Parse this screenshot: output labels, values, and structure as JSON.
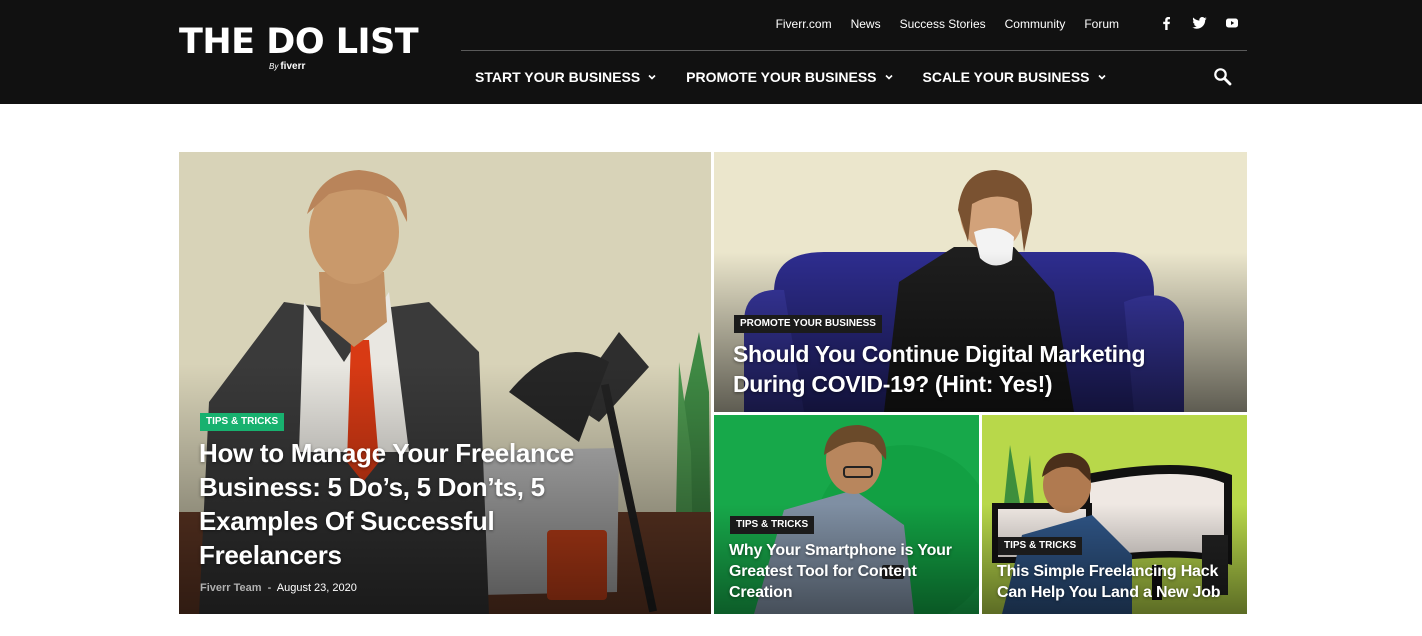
{
  "header": {
    "logo": {
      "main": "THE DO LIST",
      "by": "By",
      "brand": "fiverr"
    },
    "top_links": [
      "Fiverr.com",
      "News",
      "Success Stories",
      "Community",
      "Forum"
    ],
    "social_icons": [
      "facebook-icon",
      "twitter-icon",
      "youtube-icon"
    ],
    "nav": [
      {
        "label": "START YOUR BUSINESS"
      },
      {
        "label": "PROMOTE YOUR BUSINESS"
      },
      {
        "label": "SCALE YOUR BUSINESS"
      }
    ],
    "search_icon": "search-icon"
  },
  "posts": {
    "featured": {
      "category": "TIPS & TRICKS",
      "title": "How to Manage Your Freelance Business: 5 Do’s, 5 Don’ts, 5 Examples Of Successful Freelancers",
      "author": "Fiverr Team",
      "separator": "-",
      "date": "August 23, 2020"
    },
    "second": {
      "category": "PROMOTE YOUR BUSINESS",
      "title": "Should You Continue Digital Marketing During COVID-19? (Hint: Yes!)"
    },
    "third": {
      "category": "TIPS & TRICKS",
      "title": "Why Your Smartphone is Your Greatest Tool for Content Creation"
    },
    "fourth": {
      "category": "TIPS & TRICKS",
      "title": "This Simple Freelancing Hack Can Help You Land a New Job"
    }
  },
  "colors": {
    "header_bg": "#111111",
    "category_green": "#18b16f",
    "category_dark": "#1b1b1b"
  }
}
